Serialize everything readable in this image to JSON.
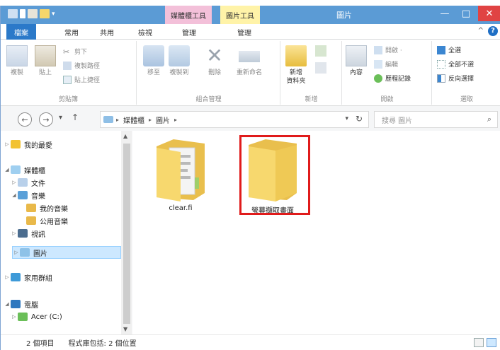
{
  "titlebar": {
    "context_tab_media": "媒體櫃工具",
    "context_tab_picture": "圖片工具",
    "window_title": "圖片",
    "minimize": "—",
    "maximize": "□",
    "close": "✕"
  },
  "tabs": {
    "file": "檔案",
    "home": "常用",
    "share": "共用",
    "view": "檢視",
    "manage1": "管理",
    "manage2": "管理",
    "collapse": "^",
    "help": "?"
  },
  "ribbon": {
    "clipboard": {
      "copy": "複製",
      "paste": "貼上",
      "cut": "剪下",
      "copy_path": "複製路徑",
      "paste_shortcut": "貼上捷徑",
      "label": "剪貼簿"
    },
    "organize": {
      "move_to": "移至",
      "copy_to": "複製到",
      "delete": "刪除",
      "rename": "重新命名",
      "label": "組合管理"
    },
    "new": {
      "new_folder_line1": "新增",
      "new_folder_line2": "資料夾",
      "label": "新增"
    },
    "open": {
      "properties": "內容",
      "open": "開啟 ·",
      "edit": "編輯",
      "history": "歷程記錄",
      "label": "開啟"
    },
    "select": {
      "select_all": "全選",
      "select_none": "全部不選",
      "invert": "反向選擇",
      "label": "選取"
    }
  },
  "address": {
    "back": "←",
    "forward": "→",
    "recent": "▾",
    "up": "↑",
    "crumbs": [
      "媒體櫃",
      "圖片"
    ],
    "search_placeholder": "搜尋 圖片",
    "dropdown": "▾",
    "refresh": "↻"
  },
  "nav": {
    "favorites": "我的最愛",
    "libraries": "媒體櫃",
    "documents": "文件",
    "music": "音樂",
    "my_music": "我的音樂",
    "public_music": "公用音樂",
    "videos": "視訊",
    "pictures": "圖片",
    "homegroup": "家用群組",
    "computer": "電腦",
    "acer_drive": "Acer (C:)"
  },
  "content": {
    "folders": [
      {
        "label": "clear.fi"
      },
      {
        "label": "螢幕擷取畫面"
      }
    ]
  },
  "status": {
    "item_count": "2 個項目",
    "library_info": "程式庫包括: 2 個位置"
  },
  "colors": {
    "title_bar": "#5b9bd5",
    "file_tab": "#2b79c9",
    "selection_bg": "#cde8ff",
    "folder_yellow": "#f5d66b",
    "highlight_red": "#e01b1b"
  }
}
